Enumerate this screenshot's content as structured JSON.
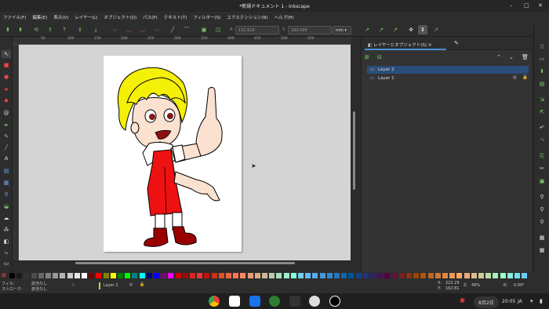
{
  "window": {
    "title": "*新規ドキュメント 1 - Inkscape"
  },
  "menu": [
    "ファイル(F)",
    "編集(E)",
    "表示(V)",
    "レイヤー(L)",
    "オブジェクト(O)",
    "パス(P)",
    "テキスト(T)",
    "フィルター(S)",
    "エクステンション(N)",
    "ヘルプ(H)"
  ],
  "toolbar": {
    "x_label": "X:",
    "x_value": "132.614",
    "y_label": "Y:",
    "y_value": "190.090",
    "unit": "mm"
  },
  "ruler": {
    "marks": [
      "50",
      "100",
      "150",
      "200",
      "250",
      "300",
      "350",
      "400",
      "450",
      "500",
      "550"
    ]
  },
  "panel": {
    "tab_label": "レイヤーとオブジェクト(S)",
    "layers": [
      {
        "name": "Layer 2",
        "selected": true
      },
      {
        "name": "Layer 1",
        "selected": false
      }
    ]
  },
  "status": {
    "fill_label": "フィル:",
    "fill_value": "該当なし",
    "stroke_label": "ストローク:",
    "stroke_value": "該当なし",
    "opacity": "0",
    "layer": "Layer 2",
    "x_label": "X:",
    "x_coord": "222.29",
    "y_label": "Y:",
    "y_coord": "162.81",
    "zoom_label": "Z:",
    "zoom": "49%",
    "rot_label": "R:",
    "rotation": "0.00°"
  },
  "taskbar": {
    "date": "8月2日",
    "time": "20:05",
    "lang": "JA"
  },
  "colors": {
    "accent": "#7fd06a",
    "selection": "#2a4d7a"
  }
}
